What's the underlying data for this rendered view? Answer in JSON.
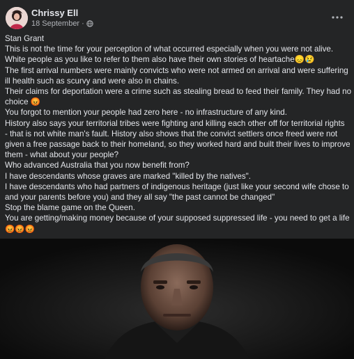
{
  "post": {
    "author": "Chrissy Ell",
    "date": "18 September",
    "separator": "·",
    "privacy_icon": "globe-icon",
    "more_icon": "more-options-icon",
    "lines": [
      "Stan Grant",
      "This is not the time for your perception of what occurred especially when you were not alive.",
      "White people as you like to refer to them also have their own stories of heartache😞😢",
      "The first arrival numbers were mainly convicts who were not armed on arrival and were suffering",
      "ill health such as scurvy and were also in chains.",
      "Their claims for deportation were a crime such as stealing bread to feed their family. They had no",
      "choice 😡",
      "You forgot to mention your people had zero here - no infrastructure of any kind.",
      "History also says your territorial tribes were fighting and killing each other off for territorial rights",
      "- that is not white man's fault. History also shows that the convict settlers once freed were not",
      "given a free passage back to their homeland, so they worked hard and built their lives to improve",
      "them - what about your people?",
      "Who advanced Australia that you now benefit from?",
      "I have descendants whose graves are marked \"killed by the natives\".",
      "I have descendants who had partners of indigenous heritage (just like your second wife chose to",
      "and your parents before you) and they all say \"the past cannot be changed\"",
      "Stop the blame game on the Queen.",
      "You are getting/making money because of your supposed suppressed life  - you need to get a life",
      "😡😡😡"
    ]
  },
  "colors": {
    "background": "#242526",
    "text_primary": "#e4e6eb",
    "text_secondary": "#b0b3b8"
  }
}
